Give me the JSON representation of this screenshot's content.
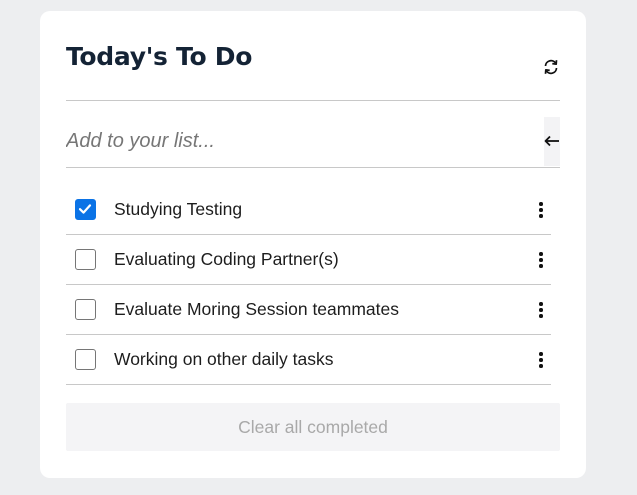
{
  "header": {
    "title": "Today's To Do"
  },
  "add_input": {
    "placeholder": "Add to your list..."
  },
  "tasks": [
    {
      "label": "Studying Testing",
      "completed": true
    },
    {
      "label": "Evaluating Coding Partner(s)",
      "completed": false
    },
    {
      "label": "Evaluate Moring Session teammates",
      "completed": false
    },
    {
      "label": "Working on other daily tasks",
      "completed": false
    }
  ],
  "clear_button": {
    "label": "Clear all completed"
  },
  "icons": {
    "refresh": "refresh-icon",
    "enter": "left-arrow-icon",
    "menu": "kebab-menu-icon",
    "check": "checkmark-icon"
  },
  "colors": {
    "title": "#142335",
    "checkbox_checked": "#0b73e6",
    "clear_text": "#a9a9a9",
    "card_bg": "#ffffff",
    "page_bg": "#edeef0"
  }
}
